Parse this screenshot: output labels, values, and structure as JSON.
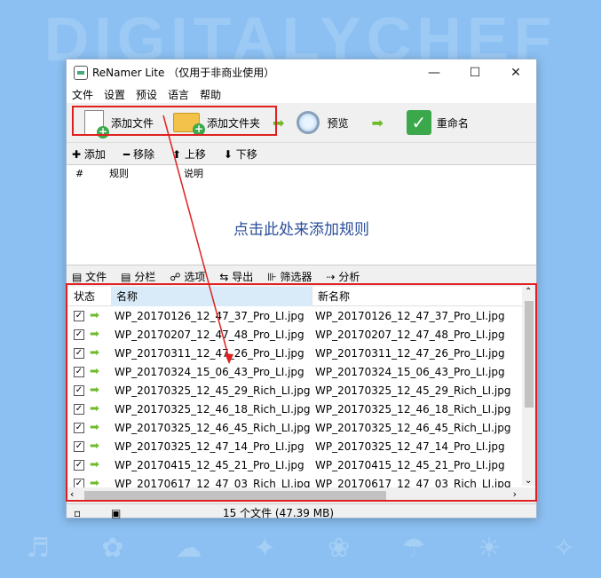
{
  "background": {
    "watermark": "DIGITALYCHEF",
    "accent": "#8cc0f2"
  },
  "window": {
    "title": "ReNamer Lite （仅用于非商业使用）",
    "controls": {
      "minimize": "—",
      "maximize": "☐",
      "close": "✕"
    }
  },
  "menu": [
    "文件",
    "设置",
    "预设",
    "语言",
    "帮助"
  ],
  "toolbar": {
    "add_files": "添加文件",
    "add_folders": "添加文件夹",
    "preview": "预览",
    "rename": "重命名"
  },
  "rules_toolbar": {
    "add": "添加",
    "remove": "移除",
    "up": "上移",
    "down": "下移"
  },
  "rules_table": {
    "columns": [
      "#",
      "规则",
      "说明"
    ],
    "empty_hint": "点击此处来添加规则"
  },
  "files_toolbar": [
    "文件",
    "分栏",
    "选项",
    "导出",
    "筛选器",
    "分析"
  ],
  "files_table": {
    "columns": {
      "status": "状态",
      "name": "名称",
      "new_name": "新名称"
    },
    "rows": [
      {
        "name": "WP_20170126_12_47_37_Pro_LI.jpg",
        "new_name": "WP_20170126_12_47_37_Pro_LI.jpg"
      },
      {
        "name": "WP_20170207_12_47_48_Pro_LI.jpg",
        "new_name": "WP_20170207_12_47_48_Pro_LI.jpg"
      },
      {
        "name": "WP_20170311_12_47_26_Pro_LI.jpg",
        "new_name": "WP_20170311_12_47_26_Pro_LI.jpg"
      },
      {
        "name": "WP_20170324_15_06_43_Pro_LI.jpg",
        "new_name": "WP_20170324_15_06_43_Pro_LI.jpg"
      },
      {
        "name": "WP_20170325_12_45_29_Rich_LI.jpg",
        "new_name": "WP_20170325_12_45_29_Rich_LI.jpg"
      },
      {
        "name": "WP_20170325_12_46_18_Rich_LI.jpg",
        "new_name": "WP_20170325_12_46_18_Rich_LI.jpg"
      },
      {
        "name": "WP_20170325_12_46_45_Rich_LI.jpg",
        "new_name": "WP_20170325_12_46_45_Rich_LI.jpg"
      },
      {
        "name": "WP_20170325_12_47_14_Pro_LI.jpg",
        "new_name": "WP_20170325_12_47_14_Pro_LI.jpg"
      },
      {
        "name": "WP_20170415_12_45_21_Pro_LI.jpg",
        "new_name": "WP_20170415_12_45_21_Pro_LI.jpg"
      },
      {
        "name": "WP_20170617_12_47_03_Rich_LI.jpg",
        "new_name": "WP_20170617_12_47_03_Rich_LI.jpg"
      }
    ]
  },
  "status": {
    "file_count": "15 个文件 (47.39 MB)"
  }
}
